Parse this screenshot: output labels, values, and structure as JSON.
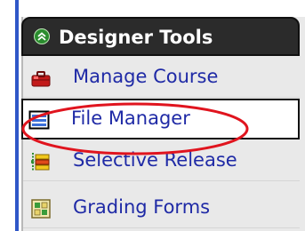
{
  "sidebar": {
    "header": {
      "title": "Designer Tools",
      "icon": "collapse-chevrons-icon"
    },
    "items": [
      {
        "label": "Manage Course",
        "icon": "toolbox-icon",
        "selected": false
      },
      {
        "label": "File Manager",
        "icon": "file-manager-icon",
        "selected": true
      },
      {
        "label": "Selective Release",
        "icon": "selective-release-icon",
        "selected": false
      },
      {
        "label": "Grading Forms",
        "icon": "grading-forms-icon",
        "selected": false
      }
    ]
  },
  "colors": {
    "link": "#1f2aa6",
    "header_bg": "#2b2b2b",
    "panel_bg": "#e9e9e9",
    "highlight": "#e0141e",
    "accent_rule": "#2f57c8"
  }
}
